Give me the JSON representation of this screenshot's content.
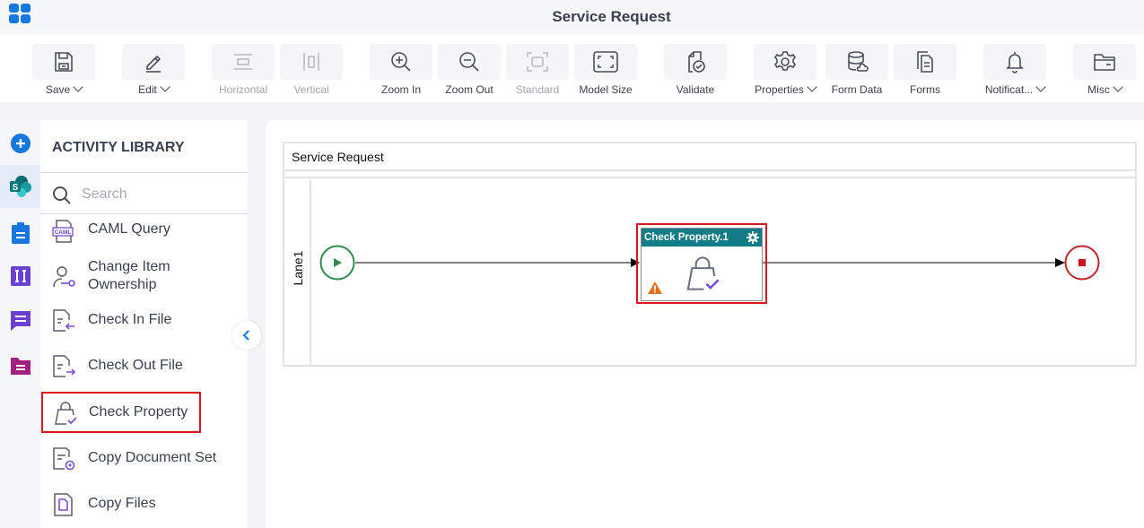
{
  "header": {
    "title": "Service Request"
  },
  "toolbar": {
    "buttons": [
      {
        "label": "Save",
        "icon": "save-icon",
        "dropdown": true,
        "disabled": false
      },
      {
        "label": "Edit",
        "icon": "pencil-icon",
        "dropdown": true,
        "disabled": false
      },
      {
        "label": "Horizontal",
        "icon": "horizontal-layout-icon",
        "dropdown": false,
        "disabled": true
      },
      {
        "label": "Vertical",
        "icon": "vertical-layout-icon",
        "dropdown": false,
        "disabled": true
      },
      {
        "label": "Zoom In",
        "icon": "zoom-in-icon",
        "dropdown": false,
        "disabled": false
      },
      {
        "label": "Zoom Out",
        "icon": "zoom-out-icon",
        "dropdown": false,
        "disabled": false
      },
      {
        "label": "Standard",
        "icon": "standard-size-icon",
        "dropdown": false,
        "disabled": true
      },
      {
        "label": "Model Size",
        "icon": "model-size-icon",
        "dropdown": false,
        "disabled": false
      },
      {
        "label": "Validate",
        "icon": "validate-icon",
        "dropdown": false,
        "disabled": false
      },
      {
        "label": "Properties",
        "icon": "gear-icon",
        "dropdown": true,
        "disabled": false
      },
      {
        "label": "Form Data",
        "icon": "database-icon",
        "dropdown": false,
        "disabled": false
      },
      {
        "label": "Forms",
        "icon": "forms-icon",
        "dropdown": false,
        "disabled": false
      },
      {
        "label": "Notificat...",
        "icon": "bell-icon",
        "dropdown": true,
        "disabled": false
      },
      {
        "label": "Misc",
        "icon": "folder-icon",
        "dropdown": true,
        "disabled": false
      }
    ]
  },
  "left_rail": {
    "items": [
      {
        "name": "add",
        "icon": "plus-circle-icon"
      },
      {
        "name": "sharepoint",
        "icon": "sharepoint-icon",
        "active": true
      },
      {
        "name": "clipboard",
        "icon": "clipboard-icon"
      },
      {
        "name": "integration",
        "icon": "integration-icon"
      },
      {
        "name": "chat",
        "icon": "chat-icon"
      },
      {
        "name": "folder",
        "icon": "folder-doc-icon"
      }
    ]
  },
  "library": {
    "title": "ACTIVITY LIBRARY",
    "search_placeholder": "Search",
    "items": [
      {
        "label": "CAML Query",
        "icon": "caml-icon"
      },
      {
        "label": "Change Item Ownership",
        "icon": "change-owner-icon"
      },
      {
        "label": "Check In File",
        "icon": "check-in-icon"
      },
      {
        "label": "Check Out File",
        "icon": "check-out-icon"
      },
      {
        "label": "Check Property",
        "icon": "check-property-icon",
        "highlighted": true
      },
      {
        "label": "Copy Document Set",
        "icon": "copy-docset-icon"
      },
      {
        "label": "Copy Files",
        "icon": "copy-files-icon"
      }
    ]
  },
  "canvas": {
    "pool_title": "Service Request",
    "lane_label": "Lane1",
    "task_title": "Check Property.1",
    "colors": {
      "task_header": "#147c86",
      "start": "#2e8b4e",
      "end": "#c0272d",
      "highlight": "#e0141b",
      "warning": "#e07020"
    }
  }
}
